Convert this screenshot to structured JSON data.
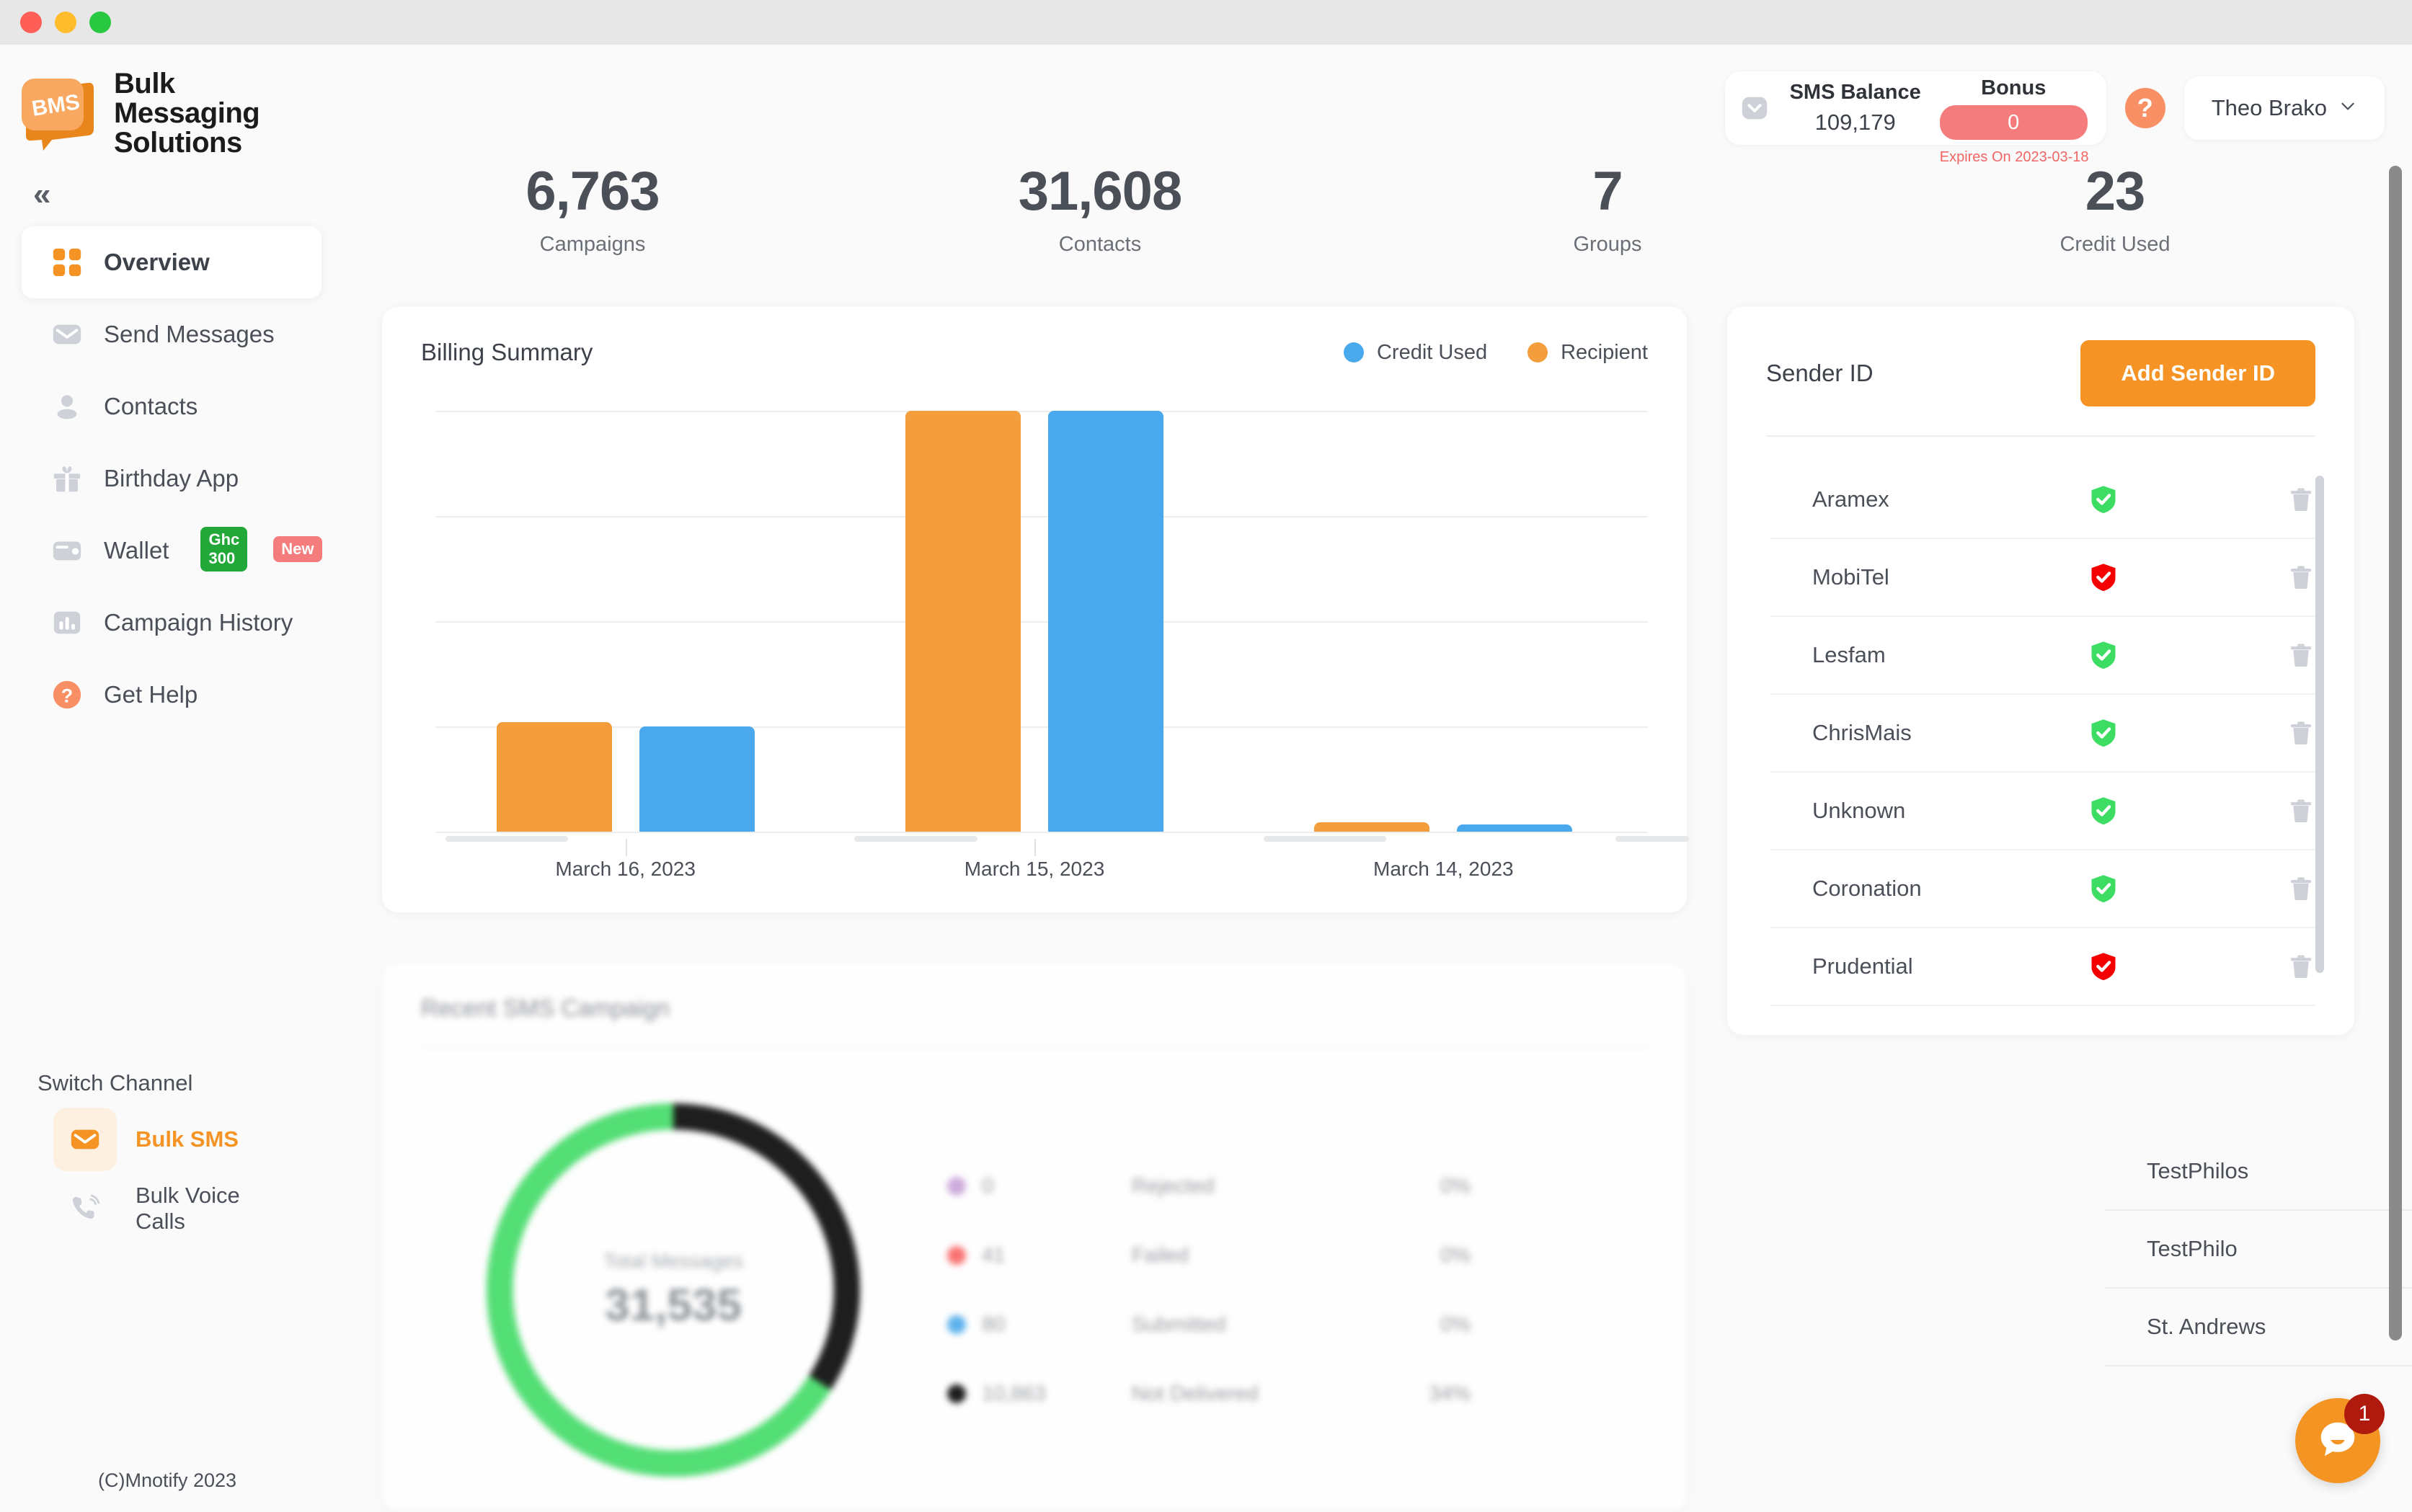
{
  "brand": {
    "logo_text": "BMS",
    "name_line1": "Bulk",
    "name_line2": "Messaging",
    "name_line3": "Solutions",
    "collapse_glyph": "«"
  },
  "sidebar": {
    "items": [
      {
        "label": "Overview",
        "icon": "grid-icon",
        "active": true
      },
      {
        "label": "Send Messages",
        "icon": "envelope-icon",
        "active": false
      },
      {
        "label": "Contacts",
        "icon": "person-icon",
        "active": false
      },
      {
        "label": "Birthday App",
        "icon": "gift-icon",
        "active": false
      },
      {
        "label": "Wallet",
        "icon": "wallet-icon",
        "active": false,
        "badge1": "Ghc 300",
        "badge2": "New"
      },
      {
        "label": "Campaign History",
        "icon": "bar-chart-icon",
        "active": false
      },
      {
        "label": "Get Help",
        "icon": "question-circle-icon",
        "active": false
      }
    ],
    "switch_channel_title": "Switch Channel",
    "channels": [
      {
        "label": "Bulk SMS",
        "icon": "envelope-icon",
        "active": true
      },
      {
        "label": "Bulk Voice Calls",
        "icon": "phone-icon",
        "active": false
      }
    ],
    "copyright": "(C)Mnotify 2023"
  },
  "header": {
    "mail_icon": "envelope-icon",
    "sms_balance_label": "SMS Balance",
    "sms_balance_value": "109,179",
    "bonus_label": "Bonus",
    "bonus_value": "0",
    "bonus_expires": "Expires On 2023-03-18",
    "help_glyph": "?",
    "user_name": "Theo Brako",
    "user_chevron": "⌄"
  },
  "stats": [
    {
      "value": "6,763",
      "label": "Campaigns"
    },
    {
      "value": "31,608",
      "label": "Contacts"
    },
    {
      "value": "7",
      "label": "Groups"
    },
    {
      "value": "23",
      "label": "Credit Used"
    }
  ],
  "billing": {
    "title": "Billing Summary",
    "legend": [
      {
        "label": "Credit Used",
        "color": "#4aa9ec"
      },
      {
        "label": "Recipient",
        "color": "#f49d3c"
      }
    ]
  },
  "campaign": {
    "title": "Recent SMS Campaign",
    "donut_center_label": "Total Messages",
    "donut_center_value": "31,535",
    "legend": [
      {
        "count": "0",
        "status": "Rejected",
        "pct": "0%",
        "color": "#c8a2d8"
      },
      {
        "count": "41",
        "status": "Failed",
        "pct": "0%",
        "color": "#fa6161"
      },
      {
        "count": "80",
        "status": "Submitted",
        "pct": "0%",
        "color": "#4aa9ec"
      },
      {
        "count": "10,863",
        "status": "Not Delivered",
        "pct": "34%",
        "color": "#000000"
      }
    ]
  },
  "sender": {
    "title": "Sender ID",
    "add_button": "Add Sender ID",
    "rows": [
      {
        "name": "Aramex",
        "status": "verified",
        "status_color": "#3ddc63"
      },
      {
        "name": "MobiTel",
        "status": "rejected",
        "status_color": "#f50000"
      },
      {
        "name": "Lesfam",
        "status": "verified",
        "status_color": "#3ddc63"
      },
      {
        "name": "ChrisMais",
        "status": "verified",
        "status_color": "#3ddc63"
      },
      {
        "name": "Unknown",
        "status": "verified",
        "status_color": "#3ddc63"
      },
      {
        "name": "Coronation",
        "status": "verified",
        "status_color": "#3ddc63"
      },
      {
        "name": "Prudential",
        "status": "rejected",
        "status_color": "#f50000"
      }
    ],
    "overflow_rows": [
      {
        "name": "TestPhilos",
        "status": "verified",
        "status_color": "#3ddc63"
      },
      {
        "name": "TestPhilo",
        "status": "rejected",
        "status_color": "#f50000"
      },
      {
        "name": "St. Andrews",
        "status": "verified",
        "status_color": "#3ddc63"
      }
    ]
  },
  "chat": {
    "badge": "1",
    "icon": "chat-bubble-icon"
  },
  "colors": {
    "accent_orange": "#f59425",
    "bar_recipient": "#f49d3c",
    "bar_credit": "#4aa9ec",
    "danger_red": "#f47c7c",
    "success_green": "#3ddc63",
    "page_bg": "#fafafa"
  },
  "chart_data": [
    {
      "type": "bar",
      "title": "Billing Summary",
      "categories": [
        "March 16, 2023",
        "March 15, 2023",
        "March 14, 2023"
      ],
      "series": [
        {
          "name": "Recipient",
          "color": "#f49d3c",
          "values": [
            2950,
            11500,
            250
          ]
        },
        {
          "name": "Credit Used",
          "color": "#4aa9ec",
          "values": [
            2900,
            11500,
            200
          ]
        }
      ],
      "xlabel": "",
      "ylabel": "",
      "ylim": [
        0,
        12500
      ],
      "grid": true,
      "legend_position": "top-right",
      "bar_height_pct": {
        "Recipient": [
          26,
          100,
          2.2
        ],
        "Credit Used": [
          25,
          100,
          1.8
        ]
      }
    },
    {
      "type": "pie",
      "title": "Recent SMS Campaign",
      "center_label": "Total Messages",
      "center_value": "31,535",
      "labels": [
        "Rejected",
        "Failed",
        "Submitted",
        "Not Delivered"
      ],
      "values": [
        0,
        41,
        80,
        10863
      ],
      "percents": [
        "0%",
        "0%",
        "0%",
        "34%"
      ],
      "colors": [
        "#c8a2d8",
        "#fa6161",
        "#4aa9ec",
        "#000000"
      ],
      "delivered_arc_pct": 66,
      "not_delivered_arc_pct": 34,
      "legend_position": "right"
    }
  ]
}
